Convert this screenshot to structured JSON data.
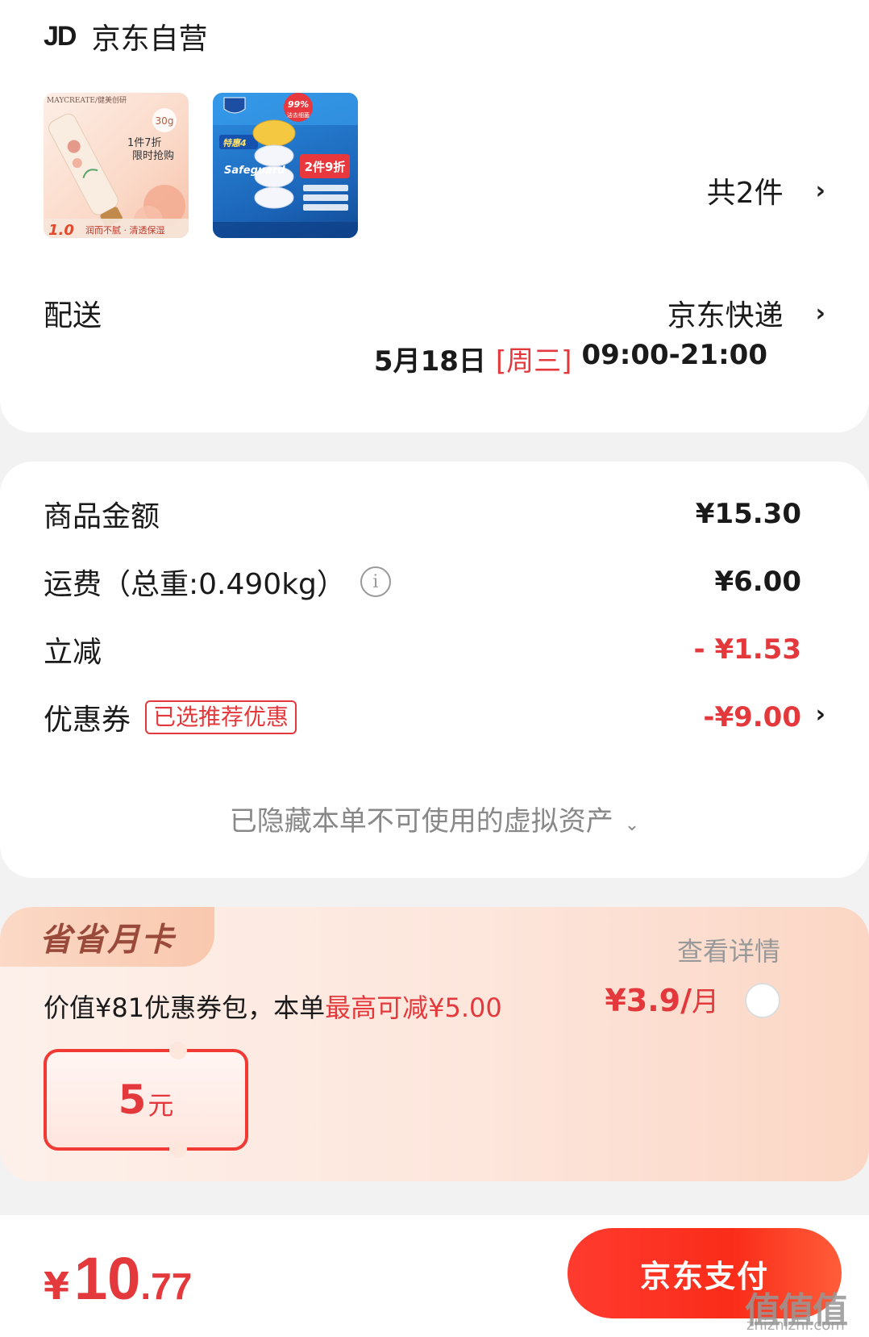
{
  "store": {
    "logo": "JD",
    "name": "京东自营"
  },
  "items": {
    "count_label": "共2件",
    "thumb1": {
      "brand": "MAYCREATE/健美创研",
      "weight": "30g",
      "promo_line1": "1件7折",
      "promo_line2": "限时抢购",
      "price_tag": "1.0",
      "tagline": "润而不腻 · 清透保湿"
    },
    "thumb2": {
      "badge_top": "99%",
      "badge_sub": "洁去细菌",
      "brand": "Safeguard",
      "deal": "特惠4",
      "discount": "2件9折"
    }
  },
  "delivery": {
    "label": "配送",
    "method": "京东快递",
    "date": "5月18日",
    "weekday": "[周三]",
    "time_range": "09:00-21:00"
  },
  "pricing": {
    "subtotal_label": "商品金额",
    "subtotal_value": "¥15.30",
    "shipping_label": "运费（总重:0.490kg）",
    "shipping_value": "¥6.00",
    "instant_discount_label": "立减",
    "instant_discount_value": "- ¥1.53",
    "coupon_label": "优惠券",
    "coupon_tag": "已选推荐优惠",
    "coupon_value": "-¥9.00",
    "hidden_assets": "已隐藏本单不可使用的虚拟资产"
  },
  "promo": {
    "badge": "省省月卡",
    "detail_link": "查看详情",
    "text_prefix": "价值¥81优惠券包，本单",
    "text_highlight": "最高可减¥5.00",
    "price": "¥3.9/",
    "price_unit": "月",
    "voucher_amount": "5",
    "voucher_unit": "元"
  },
  "footer": {
    "currency": "¥",
    "total_int": "10",
    "total_dec": ".77",
    "pay_button": "京东支付",
    "watermark": "值值值",
    "watermark_sub": "zhizhizhi.com"
  },
  "colors": {
    "accent_red": "#e4393c",
    "pay_gradient_start": "#ff3b2f",
    "promo_bg": "#fde6dc"
  }
}
